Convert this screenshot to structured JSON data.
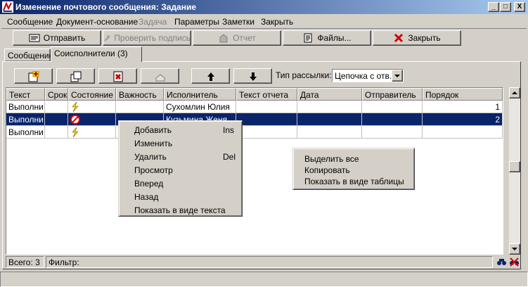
{
  "window": {
    "title": "Изменение почтового сообщения: Задание",
    "controls": [
      "_",
      "□",
      "X"
    ]
  },
  "menu": [
    "Сообщение",
    "Документ-основание",
    "Задача",
    "Параметры",
    "Заметки",
    "Закрыть"
  ],
  "toolbar": {
    "send": "Отправить",
    "check_signature": "Проверить подпись",
    "report": "Отчет",
    "files": "Файлы...",
    "close": "Закрыть"
  },
  "tabs": [
    "Сообщение",
    "Соисполнители (3)"
  ],
  "mailing": {
    "label": "Тип рассылки:",
    "value": "Цепочка с отв."
  },
  "grid": {
    "columns": [
      "Текст",
      "Срок",
      "Состояние",
      "Важность",
      "Исполнитель",
      "Текст отчета",
      "Дата",
      "Отправитель",
      "Порядок"
    ],
    "rows": [
      {
        "text": "Выполни",
        "term": "",
        "state_icon": "lightning-icon",
        "importance": "",
        "executor": "Сухомлин Юлия",
        "report": "",
        "date": "",
        "sender": "",
        "order": "1",
        "selected": false
      },
      {
        "text": "Выполни",
        "term": "",
        "state_icon": "cancel-icon",
        "importance": "",
        "executor": "Кузьмина Женя",
        "report": "",
        "date": "",
        "sender": "",
        "order": "2",
        "selected": true
      },
      {
        "text": "Выполни",
        "term": "",
        "state_icon": "lightning-icon",
        "importance": "",
        "executor": "",
        "report": "",
        "date": "",
        "sender": "",
        "order": "",
        "selected": false
      }
    ]
  },
  "status": {
    "total": "Всего: 3",
    "filter": "Фильтр:"
  },
  "context_menu_grid": [
    {
      "label": "Добавить",
      "key": "Ins"
    },
    {
      "label": "Изменить",
      "key": ""
    },
    {
      "label": "Удалить",
      "key": "Del"
    },
    {
      "label": "Просмотр",
      "key": ""
    },
    {
      "label": "Вперед",
      "key": ""
    },
    {
      "label": "Назад",
      "key": ""
    },
    {
      "label": "Показать в виде текста",
      "key": ""
    }
  ],
  "context_menu_area": [
    {
      "label": "Выделить все"
    },
    {
      "label": "Копировать"
    },
    {
      "label": "Показать в виде таблицы"
    }
  ],
  "colors": {
    "title_start": "#0a246a",
    "title_end": "#a6caf0",
    "selection": "#0a246a",
    "face": "#d4d0c8"
  }
}
